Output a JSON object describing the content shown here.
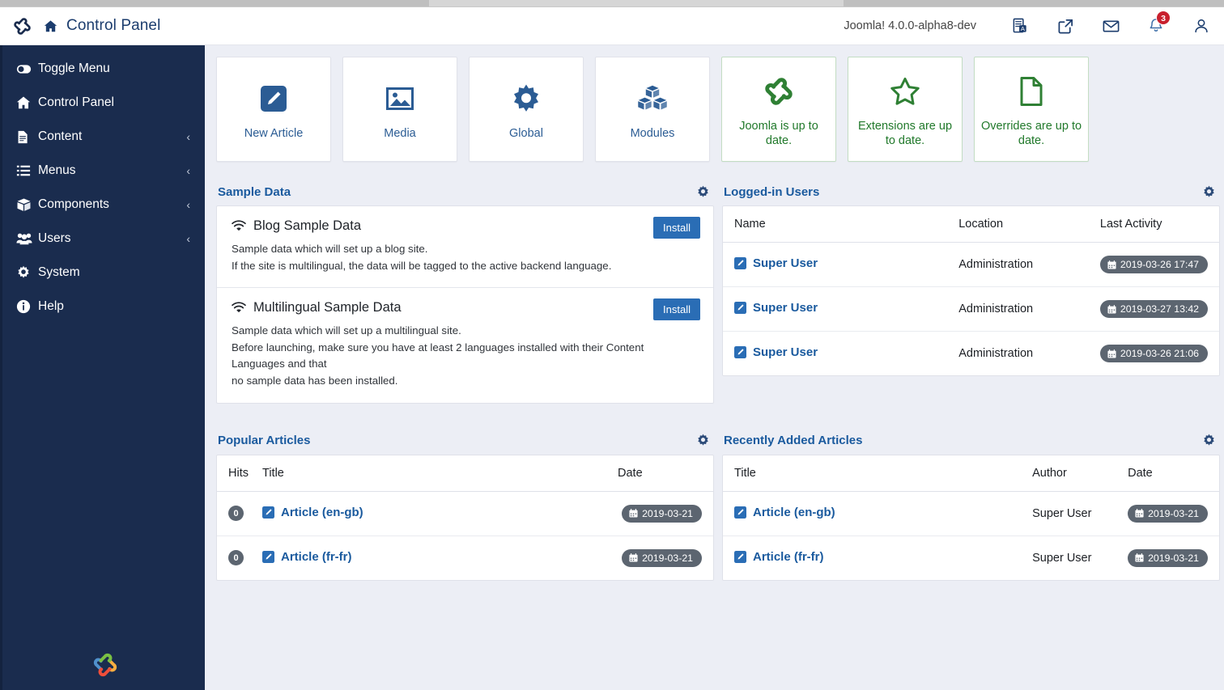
{
  "header": {
    "page_title": "Control Panel",
    "version": "Joomla! 4.0.0-alpha8-dev",
    "icons": [
      {
        "name": "multilingual-status-icon",
        "label": "Multilingual Status"
      },
      {
        "name": "view-site-icon",
        "label": "View Site"
      },
      {
        "name": "messages-icon",
        "label": "Private Messages"
      },
      {
        "name": "notifications-icon",
        "label": "Notifications"
      },
      {
        "name": "user-menu-icon",
        "label": "User Menu"
      }
    ],
    "notification_count": "3",
    "brand": "joomla-logo"
  },
  "sidebar": {
    "items": [
      {
        "label": "Toggle Menu",
        "icon": "toggle-icon",
        "caret": ""
      },
      {
        "label": "Control Panel",
        "icon": "home-icon",
        "caret": ""
      },
      {
        "label": "Content",
        "icon": "file-text-icon",
        "caret": "‹"
      },
      {
        "label": "Menus",
        "icon": "list-icon",
        "caret": "‹"
      },
      {
        "label": "Components",
        "icon": "cube-icon",
        "caret": "‹"
      },
      {
        "label": "Users",
        "icon": "users-icon",
        "caret": "‹"
      },
      {
        "label": "System",
        "icon": "gear-icon",
        "caret": ""
      },
      {
        "label": "Help",
        "icon": "info-icon",
        "caret": ""
      }
    ],
    "footer_logo": "joomla-logo"
  },
  "quick_cards": [
    {
      "label": "New Article",
      "icon": "pencil-square-icon",
      "type": "action"
    },
    {
      "label": "Media",
      "icon": "image-icon",
      "type": "action"
    },
    {
      "label": "Global",
      "icon": "gear-icon",
      "type": "action"
    },
    {
      "label": "Modules",
      "icon": "cubes-icon",
      "type": "action"
    },
    {
      "label": "Joomla is up to date.",
      "icon": "joomla-icon",
      "type": "status"
    },
    {
      "label": "Extensions are up to date.",
      "icon": "star-icon",
      "type": "status"
    },
    {
      "label": "Overrides are up to date.",
      "icon": "file-icon",
      "type": "status"
    }
  ],
  "sample_data": {
    "title": "Sample Data",
    "gear": "options-gear-icon",
    "items": [
      {
        "name": "Blog Sample Data",
        "icon": "wifi-icon",
        "desc_line1": "Sample data which will set up a blog site.",
        "desc_line2": "If the site is multilingual, the data will be tagged to the active backend language.",
        "desc_line3": "",
        "button": "Install"
      },
      {
        "name": "Multilingual Sample Data",
        "icon": "wifi-icon",
        "desc_line1": "Sample data which will set up a multilingual site.",
        "desc_line2": "Before launching, make sure you have at least 2 languages installed with their Content Languages and that",
        "desc_line3": "no sample data has been installed.",
        "button": "Install"
      }
    ]
  },
  "logged_in_users": {
    "title": "Logged-in Users",
    "gear": "options-gear-icon",
    "columns": [
      "Name",
      "Location",
      "Last Activity"
    ],
    "rows": [
      {
        "name": "Super User",
        "location": "Administration",
        "last_activity": "2019-03-26 17:47"
      },
      {
        "name": "Super User",
        "location": "Administration",
        "last_activity": "2019-03-27 13:42"
      },
      {
        "name": "Super User",
        "location": "Administration",
        "last_activity": "2019-03-26 21:06"
      }
    ]
  },
  "popular_articles": {
    "title": "Popular Articles",
    "gear": "options-gear-icon",
    "columns": [
      "Hits",
      "Title",
      "Date"
    ],
    "rows": [
      {
        "hits": "0",
        "title": "Article (en-gb)",
        "date": "2019-03-21"
      },
      {
        "hits": "0",
        "title": "Article (fr-fr)",
        "date": "2019-03-21"
      }
    ]
  },
  "recently_added_articles": {
    "title": "Recently Added Articles",
    "gear": "options-gear-icon",
    "columns": [
      "Title",
      "Author",
      "Date"
    ],
    "rows": [
      {
        "title": "Article (en-gb)",
        "author": "Super User",
        "date": "2019-03-21"
      },
      {
        "title": "Article (fr-fr)",
        "author": "Super User",
        "date": "2019-03-21"
      }
    ]
  },
  "colors": {
    "sidebar_bg": "#1a2c4e",
    "accent_blue": "#1a5a9e",
    "status_green": "#21792b",
    "install_blue": "#2a6db5",
    "badge_red": "#c8202e",
    "pill_gray": "#5c6570",
    "main_bg": "#eceef5"
  }
}
